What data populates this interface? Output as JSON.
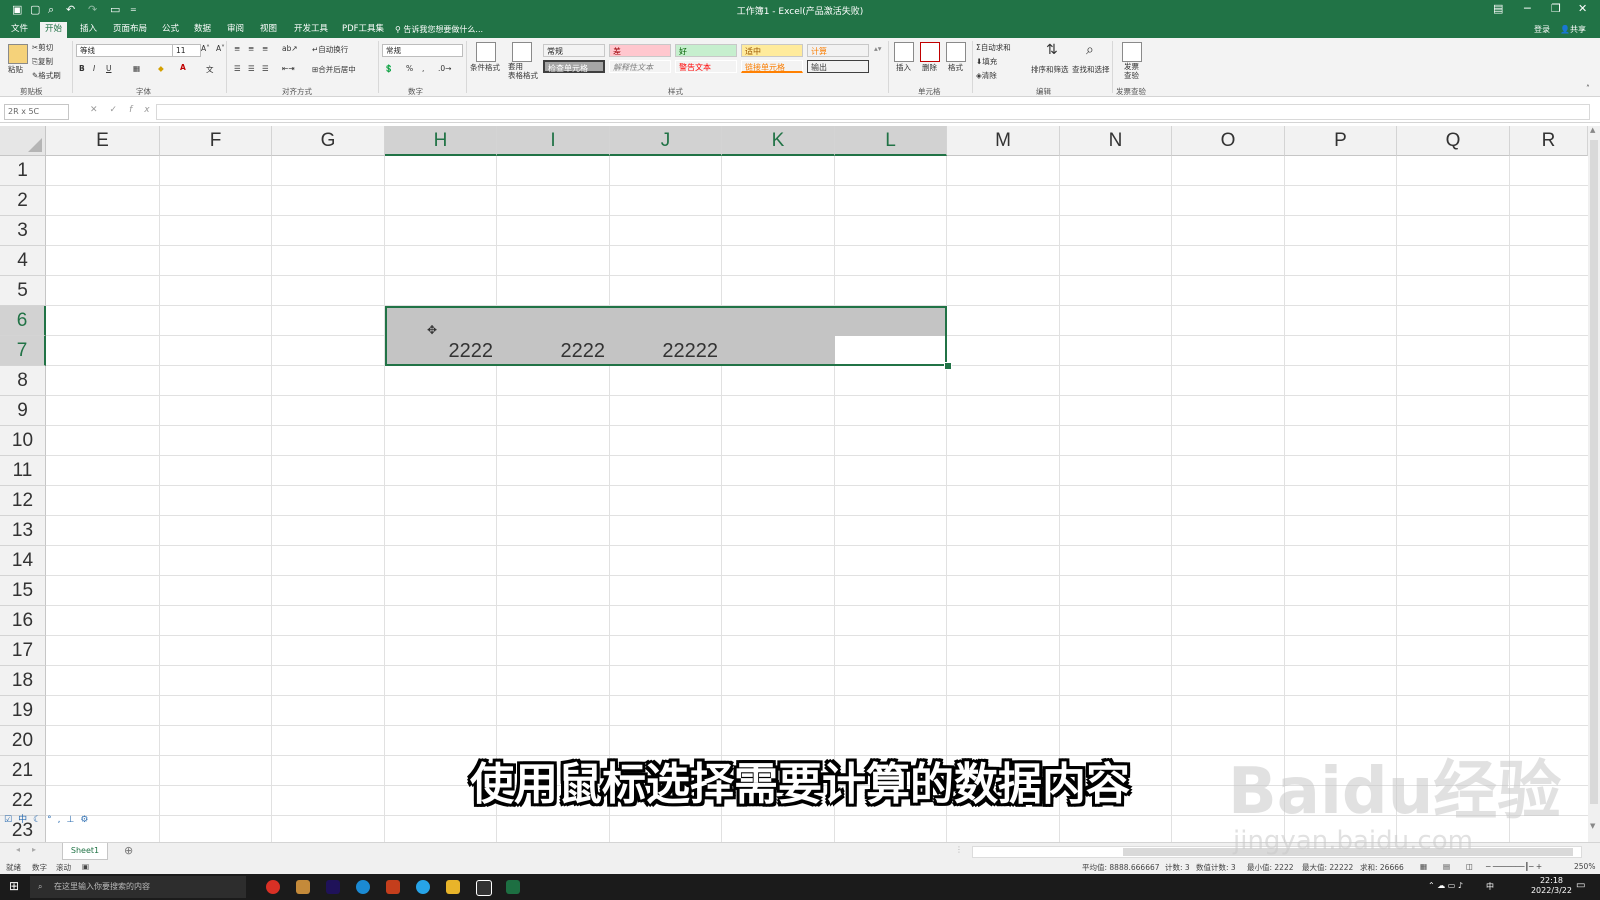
{
  "title_bar": {
    "title": "工作簿1 - Excel(产品激活失败)",
    "quick_access": [
      "save-icon",
      "new-icon",
      "preview-icon",
      "undo-icon",
      "redo-icon",
      "open-icon"
    ]
  },
  "tabs": {
    "items": [
      "文件",
      "开始",
      "插入",
      "页面布局",
      "公式",
      "数据",
      "审阅",
      "视图",
      "开发工具",
      "PDF工具集"
    ],
    "active": "开始",
    "tell_me": "告诉我您想要做什么...",
    "login": "登录",
    "share": "共享"
  },
  "ribbon": {
    "clipboard": {
      "paste": "粘贴",
      "cut": "剪切",
      "copy": "复制",
      "format_painter": "格式刷",
      "label": "剪贴板"
    },
    "font": {
      "name": "等线",
      "size": "11",
      "bold": "B",
      "italic": "I",
      "underline": "U",
      "label": "字体"
    },
    "alignment": {
      "wrap": "自动换行",
      "merge": "合并后居中",
      "label": "对齐方式"
    },
    "number": {
      "format": "常规",
      "percent": "%",
      "comma": ",",
      "label": "数字"
    },
    "styles": {
      "conditional": "条件格式",
      "table": "套用\n表格格式",
      "cells": [
        {
          "text": "常规",
          "bg": "#ffffff",
          "fg": "#000000"
        },
        {
          "text": "差",
          "bg": "#ffc7ce",
          "fg": "#9c0006"
        },
        {
          "text": "好",
          "bg": "#c6efce",
          "fg": "#006100"
        },
        {
          "text": "适中",
          "bg": "#ffeb9c",
          "fg": "#9c5700"
        },
        {
          "text": "计算",
          "bg": "#f2f2f2",
          "fg": "#fa7d00"
        },
        {
          "text": "检查单元格",
          "bg": "#a5a5a5",
          "fg": "#ffffff"
        },
        {
          "text": "解释性文本",
          "bg": "#ffffff",
          "fg": "#7f7f7f"
        },
        {
          "text": "警告文本",
          "bg": "#ffffff",
          "fg": "#ff0000"
        },
        {
          "text": "链接单元格",
          "bg": "#ffffff",
          "fg": "#fa7d00"
        },
        {
          "text": "输出",
          "bg": "#f2f2f2",
          "fg": "#3f3f3f"
        }
      ],
      "label": "样式"
    },
    "cells": {
      "insert": "插入",
      "delete": "删除",
      "format": "格式",
      "label": "单元格"
    },
    "editing": {
      "autosum": "自动求和",
      "fill": "填充",
      "clear": "清除",
      "sort": "排序和筛选",
      "find": "查找和选择",
      "label": "编辑"
    },
    "invoice": {
      "check": "发票\n查验",
      "label": "发票查验"
    }
  },
  "formula_bar": {
    "name_box": "2R x 5C",
    "fx": "fx",
    "value": ""
  },
  "grid": {
    "columns": [
      "E",
      "F",
      "G",
      "H",
      "I",
      "J",
      "K",
      "L",
      "M",
      "N",
      "O",
      "P",
      "Q",
      "R"
    ],
    "selected_columns": [
      "H",
      "I",
      "J",
      "K",
      "L"
    ],
    "rows": [
      "1",
      "2",
      "3",
      "4",
      "5",
      "6",
      "7",
      "8",
      "9",
      "10",
      "11",
      "12",
      "13",
      "14",
      "15",
      "16",
      "17",
      "18",
      "19",
      "20",
      "21",
      "22",
      "23"
    ],
    "selected_rows": [
      "6",
      "7"
    ],
    "cells": [
      {
        "ref": "H7",
        "value": "2222"
      },
      {
        "ref": "I7",
        "value": "2222"
      },
      {
        "ref": "J7",
        "value": "22222"
      }
    ]
  },
  "sheets": {
    "tabs": [
      "Sheet1"
    ],
    "active": "Sheet1"
  },
  "status_bar": {
    "mode": "就绪",
    "num": "数字",
    "scroll": "滚动",
    "average": "平均值: 8888.666667",
    "count": "计数: 3",
    "numeric_count": "数值计数: 3",
    "min": "最小值: 2222",
    "max": "最大值: 22222",
    "sum": "求和: 26666",
    "zoom": "250%"
  },
  "taskbar": {
    "search_placeholder": "在这里输入你要搜索的内容",
    "time": "22:18",
    "date": "2022/3/22",
    "ime": "中"
  },
  "subtitle": "使用鼠标选择需要计算的数据内容",
  "watermark": {
    "logo": "Baidu经验",
    "url": "jingyan.baidu.com"
  }
}
